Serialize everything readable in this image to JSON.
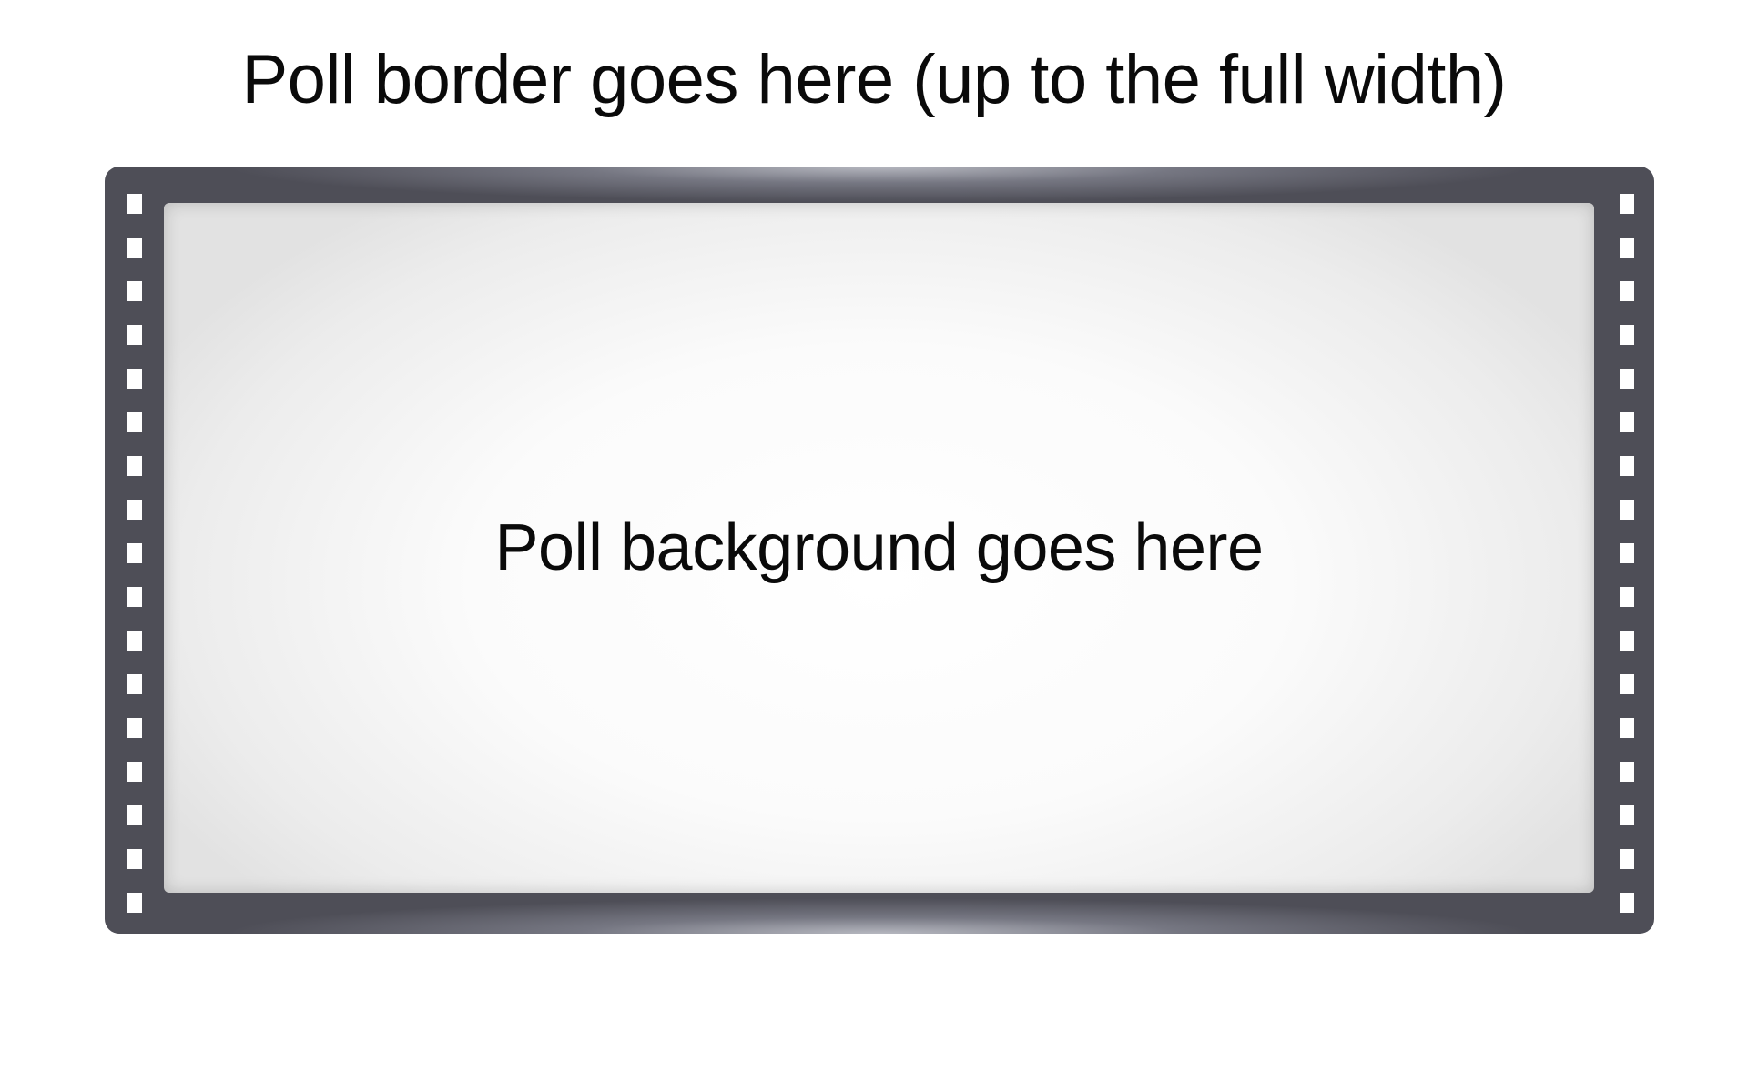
{
  "heading": "Poll border goes here (up to the full width)",
  "frame": {
    "background_label": "Poll background goes here",
    "border_color": "#4e4e57",
    "perforation_count_per_side": 17
  }
}
